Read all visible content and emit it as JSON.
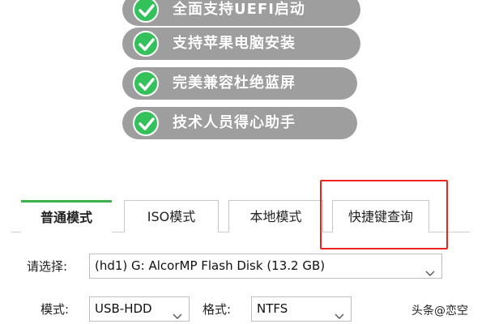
{
  "features": [
    "全面支持UEFI启动",
    "支持苹果电脑安装",
    "完美兼容杜绝蓝屏",
    "技术人员得心助手"
  ],
  "tabs": [
    {
      "label": "普通模式",
      "active": true
    },
    {
      "label": "ISO模式",
      "active": false
    },
    {
      "label": "本地模式",
      "active": false
    },
    {
      "label": "快捷键查询",
      "active": false
    }
  ],
  "device": {
    "label": "请选择:",
    "value": "(hd1) G: AlcorMP Flash Disk (13.2 GB)"
  },
  "mode": {
    "label": "模式:",
    "value": "USB-HDD"
  },
  "format": {
    "label": "格式:",
    "value": "NTFS"
  },
  "watermark": "头条@恋空",
  "colors": {
    "accent_green": "#34c05a",
    "tab_active_border": "#3db24a",
    "highlight_red": "#e8251f",
    "pill_gray": "#9e9e9e"
  },
  "icons": {
    "feature_check": "check-circle-icon",
    "dropdown": "chevron-down-icon"
  }
}
